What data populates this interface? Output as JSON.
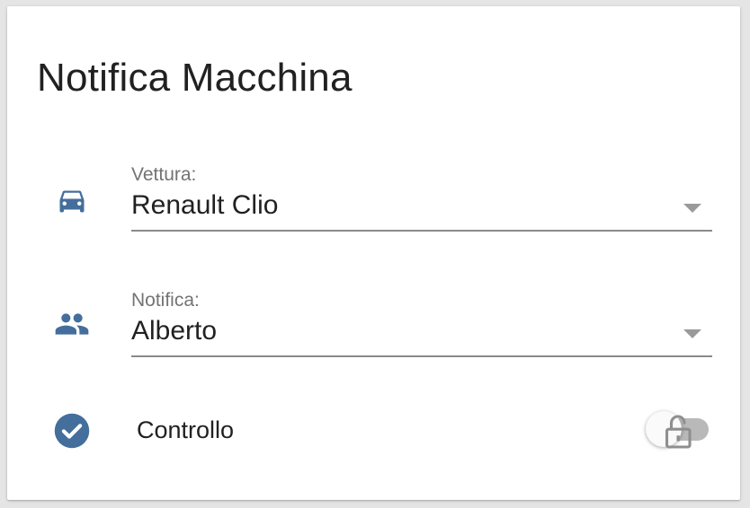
{
  "card": {
    "title": "Notifica Macchina"
  },
  "car_field": {
    "icon": "car-icon",
    "label": "Vettura:",
    "value": "Renault Clio"
  },
  "notify_field": {
    "icon": "people-icon",
    "label": "Notifica:",
    "value": "Alberto"
  },
  "check_row": {
    "icon": "check-circle-icon",
    "label": "Controllo",
    "toggle_on": false,
    "toggle_icon": "lock-open-icon"
  },
  "colors": {
    "icon_blue": "#446e9b",
    "text": "#212121",
    "label_gray": "#737373"
  }
}
